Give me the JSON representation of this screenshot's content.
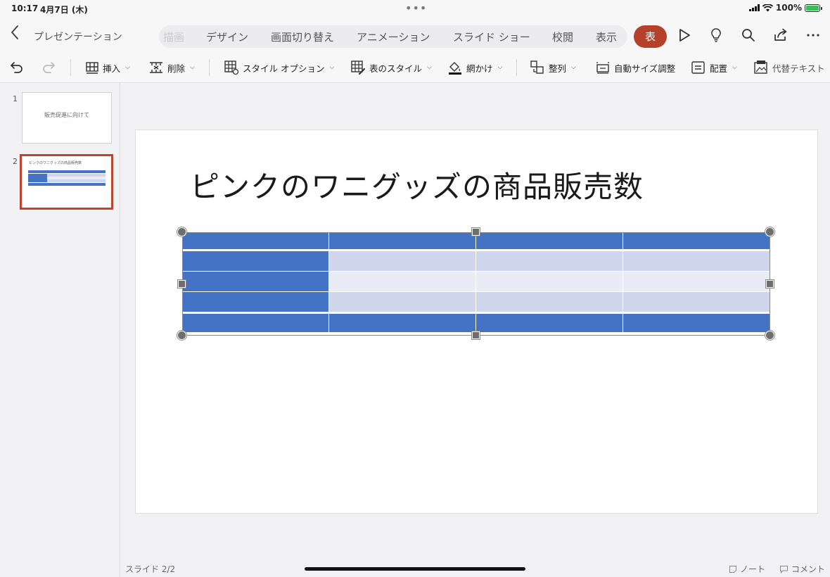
{
  "status": {
    "time": "10:17",
    "date": "4月7日 (木)",
    "battery": "100%"
  },
  "header": {
    "doc_title": "プレゼンテーション",
    "tabs": [
      {
        "label": "描画",
        "faded": true
      },
      {
        "label": "デザイン"
      },
      {
        "label": "画面切り替え"
      },
      {
        "label": "アニメーション"
      },
      {
        "label": "スライド ショー"
      },
      {
        "label": "校閲"
      },
      {
        "label": "表示"
      }
    ],
    "active_tab": "表",
    "accent_color": "#b5412b"
  },
  "ribbon": {
    "insert": "挿入",
    "delete": "削除",
    "style_options": "スタイル オプション",
    "table_styles": "表のスタイル",
    "shading": "網かけ",
    "arrange": "整列",
    "autofit": "自動サイズ調整",
    "align": "配置",
    "alt_text": "代替テキスト"
  },
  "thumbnails": [
    {
      "number": "1",
      "title": "販売促進に向けて",
      "subtitle": "・・・・・"
    },
    {
      "number": "2",
      "title": "ピンクのワニグッズの商品販売数",
      "selected": true
    }
  ],
  "slide": {
    "title": "ピンクのワニグッズの商品販売数",
    "table": {
      "rows": 5,
      "cols": 4,
      "header_color": "#4472c4",
      "band_color_1": "#cfd5ea",
      "band_color_2": "#e9ebf5"
    }
  },
  "footer": {
    "slide_counter": "スライド 2/2",
    "notes": "ノート",
    "comments": "コメント"
  }
}
